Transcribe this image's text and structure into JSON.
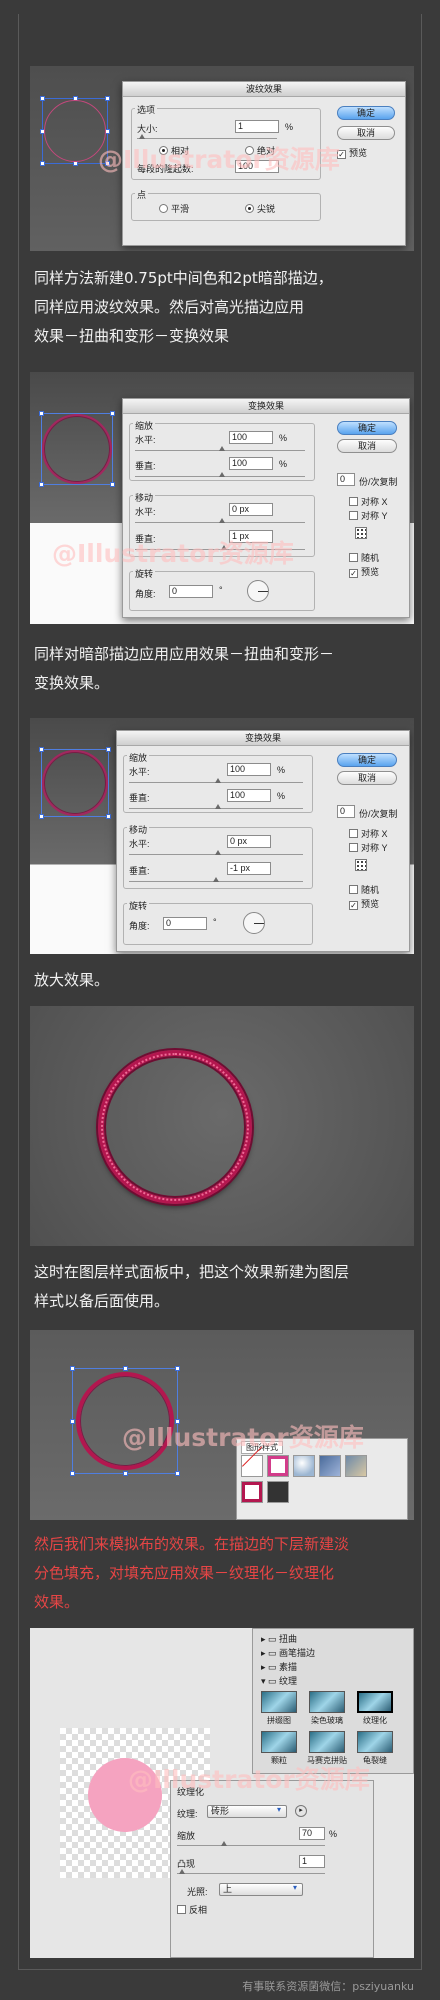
{
  "watermark": "@Illustrator资源库",
  "shot1": {
    "dialog_title": "波纹效果",
    "options_label": "选项",
    "size_label": "大小:",
    "size_value": "1",
    "size_unit": "%",
    "relative_label": "相对",
    "absolute_label": "绝对",
    "ridges_label": "每段的隆起数:",
    "ridges_value": "100",
    "point_label": "点",
    "smooth_label": "平滑",
    "corner_label": "尖锐",
    "ok_label": "确定",
    "cancel_label": "取消",
    "preview_label": "预览"
  },
  "caption1": [
    "同样方法新建0.75pt中间色和2pt暗部描边，",
    "同样应用波纹效果。然后对高光描边应用",
    "效果－扭曲和变形－变换效果"
  ],
  "shot2": {
    "dialog_title": "变换效果",
    "scale_label": "缩放",
    "h_label": "水平:",
    "h_value": "100",
    "v_label": "垂直:",
    "v_value": "100",
    "pct": "%",
    "move_label": "移动",
    "mh_label": "水平:",
    "mh_value": "0 px",
    "mv_label": "垂直:",
    "mv_value": "1 px",
    "rotate_label": "旋转",
    "angle_label": "角度:",
    "angle_value": "0",
    "deg": "°",
    "copies_value": "0",
    "copies_label": "份/次复制",
    "reflect_x": "对称 X",
    "reflect_y": "对称 Y",
    "random": "随机",
    "ok_label": "确定",
    "cancel_label": "取消",
    "preview_label": "预览"
  },
  "caption2": [
    "同样对暗部描边应用应用效果－扭曲和变形－",
    "变换效果。"
  ],
  "shot3": {
    "dialog_title": "变换效果",
    "scale_label": "缩放",
    "h_label": "水平:",
    "h_value": "100",
    "v_label": "垂直:",
    "v_value": "100",
    "pct": "%",
    "move_label": "移动",
    "mh_label": "水平:",
    "mh_value": "0 px",
    "mv_label": "垂直:",
    "mv_value": "-1 px",
    "rotate_label": "旋转",
    "angle_label": "角度:",
    "angle_value": "0",
    "deg": "°",
    "copies_value": "0",
    "copies_label": "份/次复制",
    "reflect_x": "对称 X",
    "reflect_y": "对称 Y",
    "random": "随机",
    "ok_label": "确定",
    "cancel_label": "取消",
    "preview_label": "预览"
  },
  "caption3": [
    "放大效果。"
  ],
  "caption4": [
    "这时在图层样式面板中，把这个效果新建为图层",
    "样式以备后面使用。"
  ],
  "shot5": {
    "panel_title": "图形样式"
  },
  "caption5": [
    "然后我们来模拟布的效果。在描边的下层新建淡",
    "分色填充，对填充应用效果－纹理化－纹理化",
    "效果。"
  ],
  "shot6": {
    "folders": [
      "扭曲",
      "画笔描边",
      "素描",
      "纹理"
    ],
    "thumbs": [
      "拼缀图",
      "染色玻璃",
      "纹理化",
      "颗粒",
      "马赛克拼贴",
      "龟裂缝"
    ],
    "dialog_title": "纹理化",
    "texture_label": "纹理:",
    "texture_value": "砖形",
    "scale_label": "缩放",
    "scale_value": "70",
    "scale_unit": "%",
    "relief_label": "凸现",
    "relief_value": "1",
    "light_label": "光照:",
    "light_value": "上",
    "invert_label": "反相"
  },
  "footer": "有事联系资源菌微信：psziyuanku"
}
